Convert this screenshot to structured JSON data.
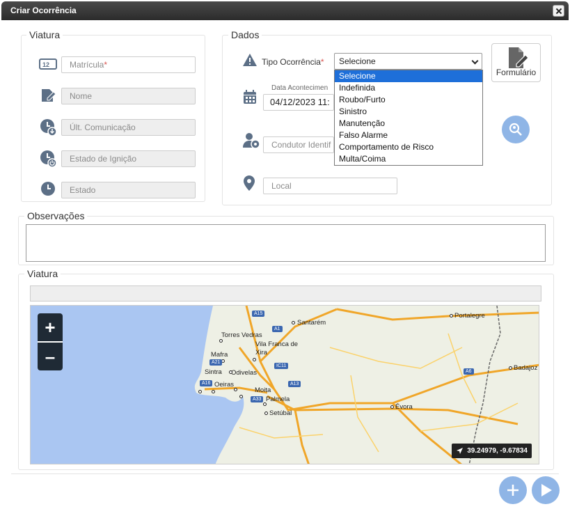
{
  "window": {
    "title": "Criar Ocorrência"
  },
  "viatura_panel": {
    "legend": "Viatura",
    "fields": [
      {
        "label": "Matrícula",
        "required_mark": "*",
        "icon": "license-plate-icon"
      },
      {
        "label": "Nome",
        "icon": "edit-signature-icon"
      },
      {
        "label": "Últ. Comunicação",
        "icon": "clock-download-icon"
      },
      {
        "label": "Estado de Ignição",
        "icon": "clock-power-icon"
      },
      {
        "label": "Estado",
        "icon": "clock-icon"
      }
    ]
  },
  "dados_panel": {
    "legend": "Dados",
    "tipo_label": "Tipo Ocorrência",
    "required_mark": "*",
    "tipo_selected": "Selecione",
    "tipo_options": [
      "Selecione",
      "Indefinida",
      "Roubo/Furto",
      "Sinistro",
      "Manutenção",
      "Falso Alarme",
      "Comportamento de Risco",
      "Multa/Coima"
    ],
    "date_label": "Data Acontecimen",
    "date_value": "04/12/2023 11:",
    "condutor_placeholder": "Condutor Identif",
    "local_placeholder": "Local",
    "form_button": "Formulário"
  },
  "observacoes": {
    "legend": "Observações"
  },
  "map_panel": {
    "legend": "Viatura",
    "coords": "39.24979, -9.67834",
    "zoom_in": "+",
    "zoom_out": "–",
    "labels": {
      "santarem": "Santarém",
      "portalegre": "Portalegre",
      "torres_vedras": "Torres Vedras",
      "vila_franca": "Vila Franca de",
      "xira": "Xira",
      "mafra": "Mafra",
      "odivelas": "Odivelas",
      "sintra": "Sintra",
      "oeiras": "Oeiras",
      "moita": "Moita",
      "palmela": "Palmela",
      "setubal": "Setúbal",
      "evora": "Évora",
      "badajoz": "Badajoz"
    },
    "roads": {
      "a15": "A15",
      "a1": "A1",
      "a21": "A21",
      "ic11": "IC11",
      "a16": "A16",
      "a13": "A13",
      "a33": "A33",
      "a6": "A6"
    }
  },
  "colors": {
    "accent": "#8fb5e6",
    "selected_option": "#1e6fd9",
    "titlebar": "#333333"
  }
}
